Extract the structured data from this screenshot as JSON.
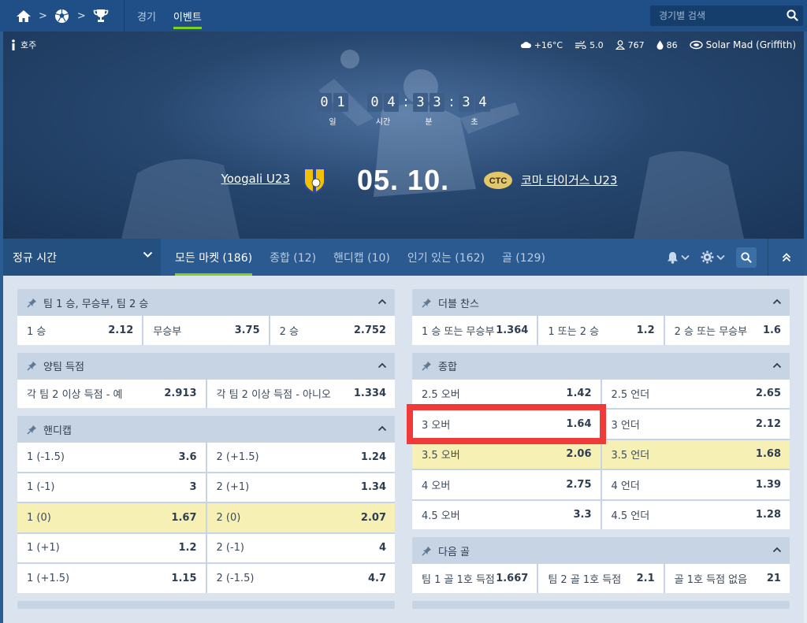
{
  "topbar": {
    "tabs": [
      {
        "label": "경기",
        "active": false
      },
      {
        "label": "이벤트",
        "active": true
      }
    ],
    "search_placeholder": "경기별 검색"
  },
  "hero": {
    "country": "호주",
    "weather": {
      "temperature": "+16°C",
      "wind": "5.0",
      "attendance": "767",
      "humidity": "86",
      "venue": "Solar Mad (Griffith)"
    },
    "countdown": {
      "days": [
        "0",
        "1"
      ],
      "hours": [
        "0",
        "4"
      ],
      "minutes": [
        "3",
        "3"
      ],
      "seconds": [
        "3",
        "4"
      ],
      "labels": {
        "days": "일",
        "hours": "시간",
        "minutes": "분",
        "seconds": "초"
      }
    },
    "home_team": "Yoogali U23",
    "away_team": "코마 타이거스 U23",
    "date": "05. 10."
  },
  "market_bar": {
    "period": "정규 시간",
    "tabs": [
      {
        "label": "모든 마켓 (186)",
        "active": true
      },
      {
        "label": "종합 (12)",
        "active": false
      },
      {
        "label": "핸디캡 (10)",
        "active": false
      },
      {
        "label": "인기 있는 (162)",
        "active": false
      },
      {
        "label": "골 (129)",
        "active": false
      }
    ]
  },
  "markets_left": [
    {
      "title": "팀 1 승, 무승부, 팀 2 승",
      "rows": [
        [
          {
            "label": "1 승",
            "value": "2.12"
          },
          {
            "label": "무승부",
            "value": "3.75"
          },
          {
            "label": "2 승",
            "value": "2.752"
          }
        ]
      ]
    },
    {
      "title": "양팀 득점",
      "rows": [
        [
          {
            "label": "각 팀 2 이상 득점 - 예",
            "value": "2.913"
          },
          {
            "label": "각 팀 2 이상 득점 - 아니오",
            "value": "1.334"
          }
        ]
      ]
    },
    {
      "title": "핸디캡",
      "rows": [
        [
          {
            "label": "1 (-1.5)",
            "value": "3.6"
          },
          {
            "label": "2 (+1.5)",
            "value": "1.24"
          }
        ],
        [
          {
            "label": "1 (-1)",
            "value": "3"
          },
          {
            "label": "2 (+1)",
            "value": "1.34"
          }
        ],
        [
          {
            "label": "1 (0)",
            "value": "1.67",
            "highlight": true
          },
          {
            "label": "2 (0)",
            "value": "2.07",
            "highlight": true
          }
        ],
        [
          {
            "label": "1 (+1)",
            "value": "1.2"
          },
          {
            "label": "2 (-1)",
            "value": "4"
          }
        ],
        [
          {
            "label": "1 (+1.5)",
            "value": "1.15"
          },
          {
            "label": "2 (-1.5)",
            "value": "4.7"
          }
        ]
      ]
    }
  ],
  "markets_right": [
    {
      "title": "더블 찬스",
      "rows": [
        [
          {
            "label": "1 승 또는 무승부",
            "value": "1.364"
          },
          {
            "label": "1 또는 2 승",
            "value": "1.2"
          },
          {
            "label": "2 승 또는 무승부",
            "value": "1.6"
          }
        ]
      ]
    },
    {
      "title": "종합",
      "rows": [
        [
          {
            "label": "2.5 오버",
            "value": "1.42"
          },
          {
            "label": "2.5 언더",
            "value": "2.65"
          }
        ],
        [
          {
            "label": "3 오버",
            "value": "1.64",
            "selected": true
          },
          {
            "label": "3 언더",
            "value": "2.12"
          }
        ],
        [
          {
            "label": "3.5 오버",
            "value": "2.06",
            "highlight": true
          },
          {
            "label": "3.5 언더",
            "value": "1.68",
            "highlight": true
          }
        ],
        [
          {
            "label": "4 오버",
            "value": "2.75"
          },
          {
            "label": "4 언더",
            "value": "1.39"
          }
        ],
        [
          {
            "label": "4.5 오버",
            "value": "3.3"
          },
          {
            "label": "4.5 언더",
            "value": "1.28"
          }
        ]
      ]
    },
    {
      "title": "다음 골",
      "rows": [
        [
          {
            "label": "팀 1 골 1호 득점",
            "value": "1.667"
          },
          {
            "label": "팀 2 골 1호 득점",
            "value": "2.1"
          },
          {
            "label": "골 1호 득점 없음",
            "value": "21"
          }
        ]
      ]
    }
  ],
  "colors": {
    "topbar": "#1f4f86",
    "accent": "#7ed321",
    "highlight_cell": "#f7f0b5",
    "selection_outline": "#f03a3a"
  }
}
